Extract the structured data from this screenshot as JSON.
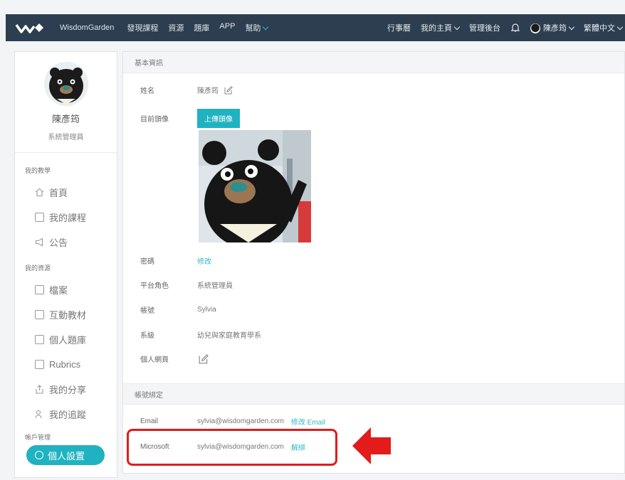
{
  "nav": {
    "brand": "WisdomGarden",
    "left_items": [
      "發現課程",
      "資源",
      "題庫",
      "APP"
    ],
    "help_label": "幫助",
    "right_items": [
      "行事曆",
      "我的主頁",
      "管理後台"
    ],
    "user_name": "陳彥筠",
    "language": "繁體中文",
    "accent_color": "#2fb8c7",
    "bar_color": "#2d3e50"
  },
  "sidebar": {
    "name": "陳彥筠",
    "role": "系統管理員",
    "groups": [
      {
        "title": "我的教學",
        "items": [
          "首頁",
          "我的課程",
          "公告"
        ]
      },
      {
        "title": "我的資源",
        "items": [
          "檔案",
          "互動教材",
          "個人題庫",
          "Rubrics",
          "我的分享",
          "我的追蹤"
        ]
      }
    ],
    "account_title": "帳戶管理",
    "active_item": "個人設置"
  },
  "basic": {
    "section_title": "基本資訊",
    "name_label": "姓名",
    "name_value": "陳彥筠",
    "avatar_label": "目前頭像",
    "upload_label": "上傳頭像",
    "password_label": "密碼",
    "password_action": "修改",
    "platform_role_label": "平台角色",
    "platform_role_value": "系統管理員",
    "account_label": "帳號",
    "account_value": "Sylvia",
    "dept_label": "系級",
    "dept_value": "幼兒與家庭教育學系",
    "homepage_label": "個人網頁"
  },
  "binding": {
    "section_title": "帳號綁定",
    "email_label": "Email",
    "email_value": "sylvia@wisdomgarden.com",
    "email_action": "修改 Email",
    "microsoft_label": "Microsoft",
    "microsoft_value": "sylvia@wisdomgarden.com",
    "microsoft_action": "解綁",
    "highlight_color": "#e31b1b"
  }
}
